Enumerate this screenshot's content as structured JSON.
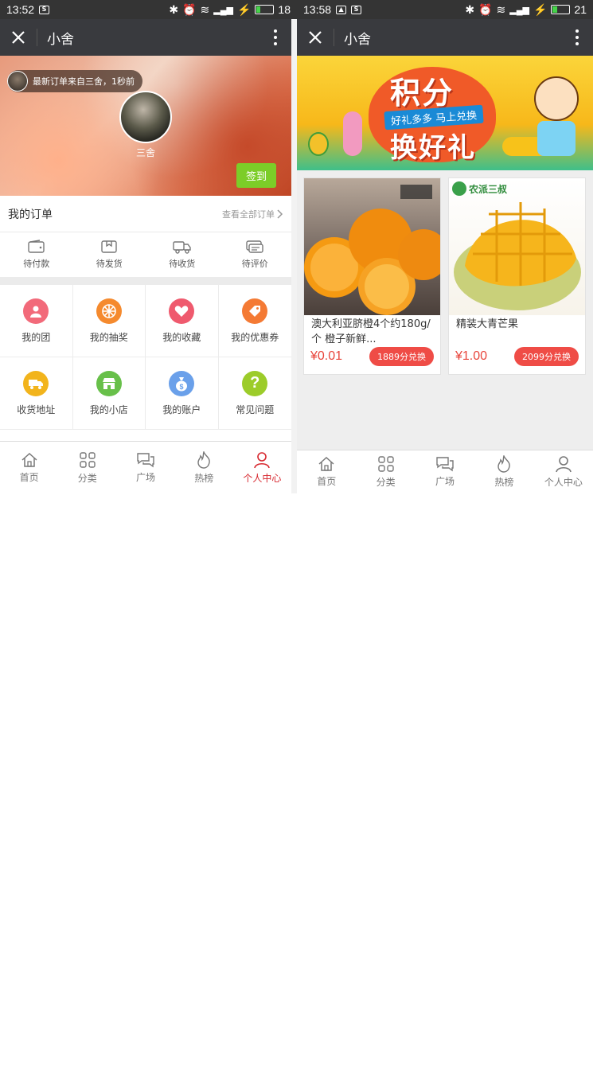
{
  "left": {
    "status": {
      "time": "13:52",
      "battery": "18"
    },
    "titlebar": {
      "title": "小舍"
    },
    "hero": {
      "notice": "最新订单来自三舍，1秒前",
      "username": "三舍",
      "signin": "签到"
    },
    "orders": {
      "title": "我的订单",
      "view_all": "查看全部订单",
      "status_items": [
        "待付款",
        "待发货",
        "待收货",
        "待评价"
      ]
    },
    "grid": [
      {
        "label": "我的团",
        "icon": "group-icon",
        "color": "#f26a7a"
      },
      {
        "label": "我的抽奖",
        "icon": "lottery-icon",
        "color": "#f58a2e"
      },
      {
        "label": "我的收藏",
        "icon": "heart-icon",
        "color": "#ef5a6e"
      },
      {
        "label": "我的优惠券",
        "icon": "coupon-icon",
        "color": "#f47a34"
      },
      {
        "label": "收货地址",
        "icon": "truck-icon",
        "color": "#f2b41c"
      },
      {
        "label": "我的小店",
        "icon": "shop-icon",
        "color": "#68c04a"
      },
      {
        "label": "我的账户",
        "icon": "money-bag-icon",
        "color": "#6aa0ea"
      },
      {
        "label": "常见问题",
        "icon": "question-icon",
        "color": "#9ccc2a"
      }
    ],
    "tabs": [
      {
        "label": "首页",
        "icon": "home-icon"
      },
      {
        "label": "分类",
        "icon": "category-icon"
      },
      {
        "label": "广场",
        "icon": "chat-icon"
      },
      {
        "label": "热榜",
        "icon": "flame-icon"
      },
      {
        "label": "个人中心",
        "icon": "person-icon",
        "active": true
      }
    ]
  },
  "right": {
    "status": {
      "time": "13:58",
      "battery": "21"
    },
    "titlebar": {
      "title": "小舍"
    },
    "banner": {
      "line1": "积分",
      "line2": "好礼多多 马上兑换",
      "line3": "换好礼"
    },
    "products": [
      {
        "name": "澳大利亚脐橙4个约180g/个 橙子新鲜...",
        "price": "¥0.01",
        "exchange": "1889分兑换"
      },
      {
        "name": "精装大青芒果",
        "price": "¥1.00",
        "exchange": "2099分兑换",
        "brand": "农派三叔"
      }
    ],
    "tabs": [
      {
        "label": "首页",
        "icon": "home-icon"
      },
      {
        "label": "分类",
        "icon": "category-icon"
      },
      {
        "label": "广场",
        "icon": "chat-icon"
      },
      {
        "label": "热榜",
        "icon": "flame-icon"
      },
      {
        "label": "个人中心",
        "icon": "person-icon"
      }
    ]
  },
  "colors": {
    "titlebar": "#393a3e",
    "accent_red": "#d7272e",
    "signin_green": "#7ccd28",
    "price_red": "#e8463c"
  }
}
